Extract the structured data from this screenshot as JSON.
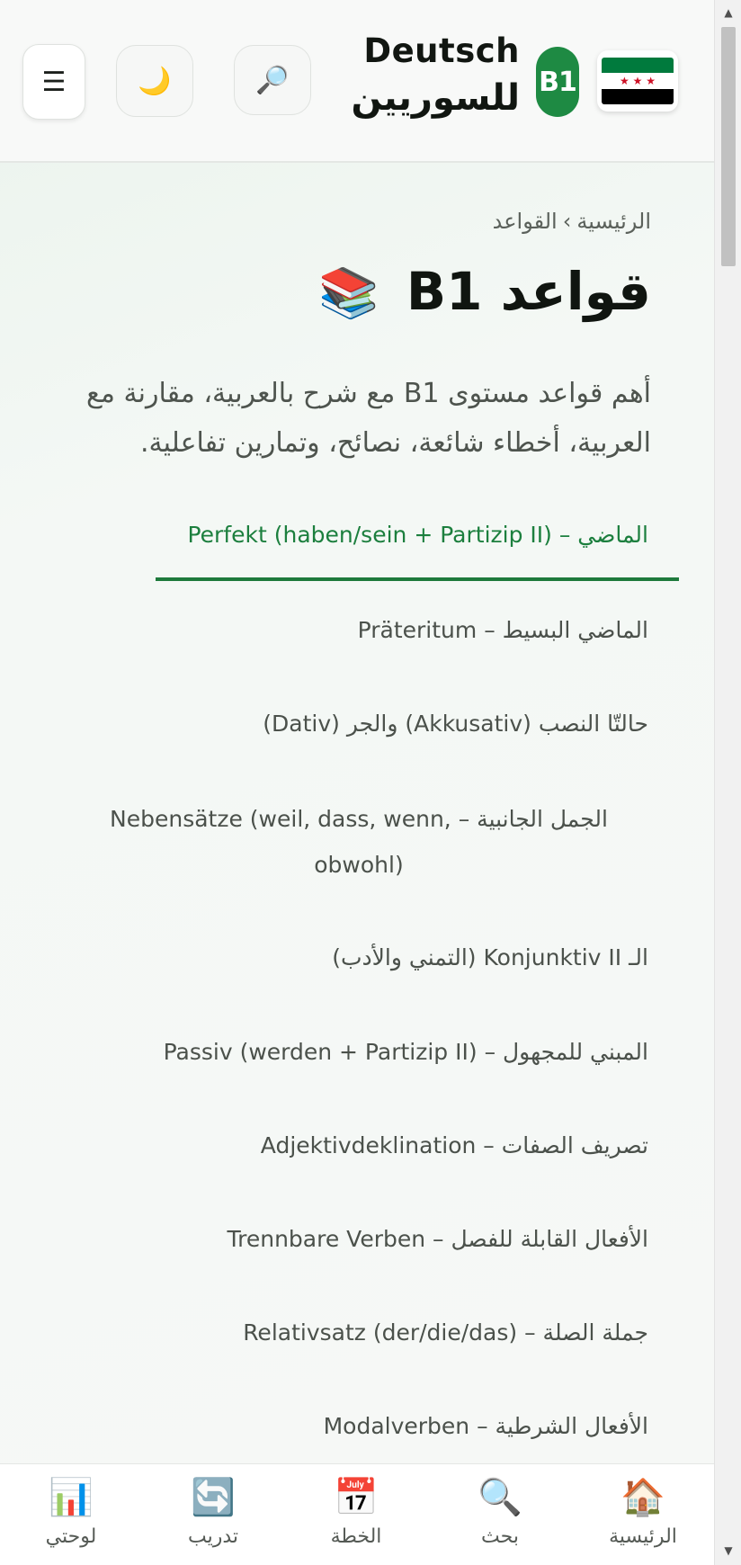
{
  "header": {
    "menu_icon": "☰",
    "theme_icon": "🌙",
    "search_icon": "🔎",
    "brand_line1": "Deutsch",
    "brand_line2": "للسوريين",
    "level_badge": "B1",
    "flag_stars": "★ ★ ★",
    "icons": {
      "menu": "menu-icon",
      "theme": "moon-icon",
      "search": "magnifier-icon",
      "flag": "syria-flag-icon"
    },
    "colors": {
      "accent": "#1e8a43",
      "flag_green": "#007a3d",
      "flag_black": "#000000",
      "flag_red": "#ce1126"
    }
  },
  "breadcrumb": {
    "home": "الرئيسية",
    "separator": "›",
    "current": "القواعد"
  },
  "page": {
    "title": "قواعد B1",
    "title_emoji": "📚",
    "intro": "أهم قواعد مستوى B1 مع شرح بالعربية، مقارنة مع العربية، أخطاء شائعة، نصائح، وتمارين تفاعلية."
  },
  "topics": [
    {
      "label": "الماضي – Perfekt (haben/sein + Partizip II)",
      "active": true
    },
    {
      "label": "الماضي البسيط – Präteritum",
      "active": false
    },
    {
      "label": "حالتّا النصب (Akkusativ) والجر (Dativ)",
      "active": false
    },
    {
      "label": "الجمل الجانبية – Nebensätze (weil, dass, wenn, obwohl)",
      "active": false
    },
    {
      "label": "الـ Konjunktiv II (التمني والأدب)",
      "active": false
    },
    {
      "label": "المبني للمجهول – Passiv (werden + Partizip II)",
      "active": false
    },
    {
      "label": "تصريف الصفات – Adjektivdeklination",
      "active": false
    },
    {
      "label": "الأفعال القابلة للفصل – Trennbare Verben",
      "active": false
    },
    {
      "label": "جملة الصلة – Relativsatz (der/die/das)",
      "active": false
    },
    {
      "label": "الأفعال الشرطية – Modalverben",
      "active": false
    }
  ],
  "bottom_nav": [
    {
      "label": "الرئيسية",
      "icon": "🏠",
      "icon_name": "home-icon"
    },
    {
      "label": "بحث",
      "icon": "🔍",
      "icon_name": "search-icon"
    },
    {
      "label": "الخطة",
      "icon": "📅",
      "icon_name": "calendar-icon"
    },
    {
      "label": "تدريب",
      "icon": "🔄",
      "icon_name": "repeat-icon"
    },
    {
      "label": "لوحتي",
      "icon": "📊",
      "icon_name": "chart-icon"
    }
  ]
}
